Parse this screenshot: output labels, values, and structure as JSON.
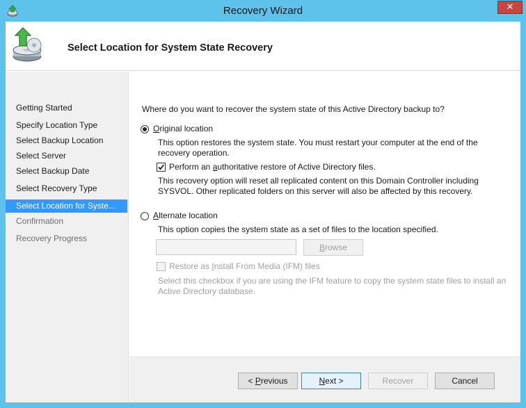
{
  "window": {
    "title": "Recovery Wizard",
    "close_glyph": "✕"
  },
  "header": {
    "title": "Select Location for System State Recovery"
  },
  "steps": [
    {
      "label": "Getting Started",
      "state": "done"
    },
    {
      "label": "Specify Location Type",
      "state": "done"
    },
    {
      "label": "Select Backup Location",
      "state": "done"
    },
    {
      "label": "Select Server",
      "state": "done"
    },
    {
      "label": "Select Backup Date",
      "state": "done"
    },
    {
      "label": "Select Recovery Type",
      "state": "done"
    },
    {
      "label": "Select Location for Syste...",
      "state": "active"
    },
    {
      "label": "Confirmation",
      "state": "pending"
    },
    {
      "label": "Recovery Progress",
      "state": "pending"
    }
  ],
  "main": {
    "question": "Where do you want to recover the system state of this Active Directory backup to?",
    "original": {
      "selected": true,
      "label_mnemonic": "O",
      "label_rest": "riginal location",
      "desc_line1": "This option restores the system state. You must restart your computer at the end of the",
      "desc_line2": "recovery operation.",
      "auth_checked": true,
      "auth_pre": "Perform an ",
      "auth_mnemonic": "a",
      "auth_post": "uthoritative restore of Active Directory files.",
      "auth_desc_line1": "This recovery option will reset all replicated content on this Domain Controller including",
      "auth_desc_line2": "SYSVOL. Other replicated folders on this server will also be affected by this recovery."
    },
    "alternate": {
      "selected": false,
      "label_mnemonic": "A",
      "label_rest": "lternate location",
      "desc": "This option copies the system state as a set of files to the location specified.",
      "path_value": "",
      "browse_mnemonic": "B",
      "browse_rest": "rowse",
      "ifm_checked": false,
      "ifm_pre": "Restore as ",
      "ifm_mnemonic": "I",
      "ifm_post": "nstall From Media (IFM) files",
      "ifm_desc_line1": "Select this checkbox if you are using the IFM feature to copy the system state files to install an",
      "ifm_desc_line2": "Active Directory database."
    }
  },
  "footer": {
    "previous_pre": "< ",
    "previous_mnemonic": "P",
    "previous_rest": "revious",
    "next_mnemonic": "N",
    "next_rest": "ext >",
    "recover": "Recover",
    "cancel": "Cancel"
  },
  "colors": {
    "frame": "#5fc2ea",
    "close": "#c7463f",
    "selection": "#3399ff",
    "disabled_text": "#a0a0a0"
  }
}
